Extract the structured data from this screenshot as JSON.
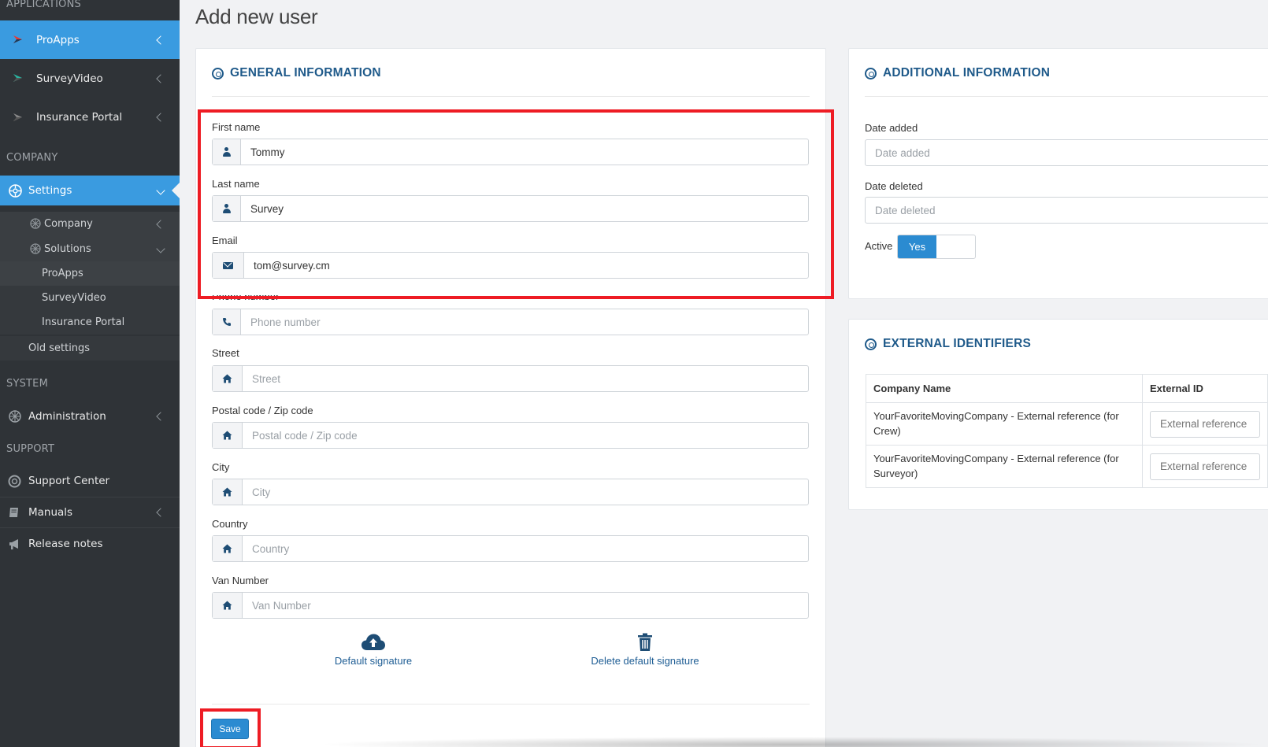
{
  "sidebar": {
    "sections": {
      "applications": "APPLICATIONS",
      "company": "COMPANY",
      "system": "SYSTEM",
      "support": "SUPPORT"
    },
    "apps": [
      {
        "label": "ProApps",
        "icon": "proapps-logo-icon"
      },
      {
        "label": "SurveyVideo",
        "icon": "surveyvideo-logo-icon"
      },
      {
        "label": "Insurance Portal",
        "icon": "insurance-portal-logo-icon"
      }
    ],
    "settings": {
      "label": "Settings",
      "icon": "settings-icon"
    },
    "settings_children": {
      "company": "Company",
      "solutions": "Solutions",
      "solutions_children": [
        "ProApps",
        "SurveyVideo",
        "Insurance Portal"
      ],
      "old_settings": "Old settings"
    },
    "administration": "Administration",
    "support_center": "Support Center",
    "manuals": "Manuals",
    "release_notes": "Release notes"
  },
  "page": {
    "title": "Add new user"
  },
  "general": {
    "heading": "GENERAL INFORMATION",
    "fields": {
      "first_name": {
        "label": "First name",
        "value": "Tommy",
        "placeholder": "First name",
        "icon": "user-icon"
      },
      "last_name": {
        "label": "Last name",
        "value": "Survey",
        "placeholder": "Last name",
        "icon": "user-icon"
      },
      "email": {
        "label": "Email",
        "value": "tom@survey.cm",
        "placeholder": "Email",
        "icon": "envelope-icon"
      },
      "phone": {
        "label": "Phone number",
        "value": "",
        "placeholder": "Phone number",
        "icon": "phone-icon"
      },
      "street": {
        "label": "Street",
        "value": "",
        "placeholder": "Street",
        "icon": "home-icon"
      },
      "postal": {
        "label": "Postal code / Zip code",
        "value": "",
        "placeholder": "Postal code / Zip code",
        "icon": "home-icon"
      },
      "city": {
        "label": "City",
        "value": "",
        "placeholder": "City",
        "icon": "home-icon"
      },
      "country": {
        "label": "Country",
        "value": "",
        "placeholder": "Country",
        "icon": "home-icon"
      },
      "van": {
        "label": "Van Number",
        "value": "",
        "placeholder": "Van Number",
        "icon": "home-icon"
      }
    },
    "default_signature": "Default signature",
    "delete_signature": "Delete default signature",
    "save": "Save"
  },
  "additional": {
    "heading": "ADDITIONAL INFORMATION",
    "date_added": {
      "label": "Date added",
      "placeholder": "Date added"
    },
    "date_deleted": {
      "label": "Date deleted",
      "placeholder": "Date deleted"
    },
    "active": {
      "label": "Active",
      "value": "Yes"
    }
  },
  "external": {
    "heading": "EXTERNAL IDENTIFIERS",
    "columns": [
      "Company Name",
      "External ID"
    ],
    "rows": [
      {
        "company": "YourFavoriteMovingCompany - External reference (for Crew)",
        "placeholder": "External reference"
      },
      {
        "company": "YourFavoriteMovingCompany - External reference (for Surveyor)",
        "placeholder": "External reference"
      }
    ]
  },
  "colors": {
    "sidebar_bg": "#2f3337",
    "accent": "#3a9be0",
    "heading": "#1f5a8a",
    "highlight": "#ee1c24"
  }
}
